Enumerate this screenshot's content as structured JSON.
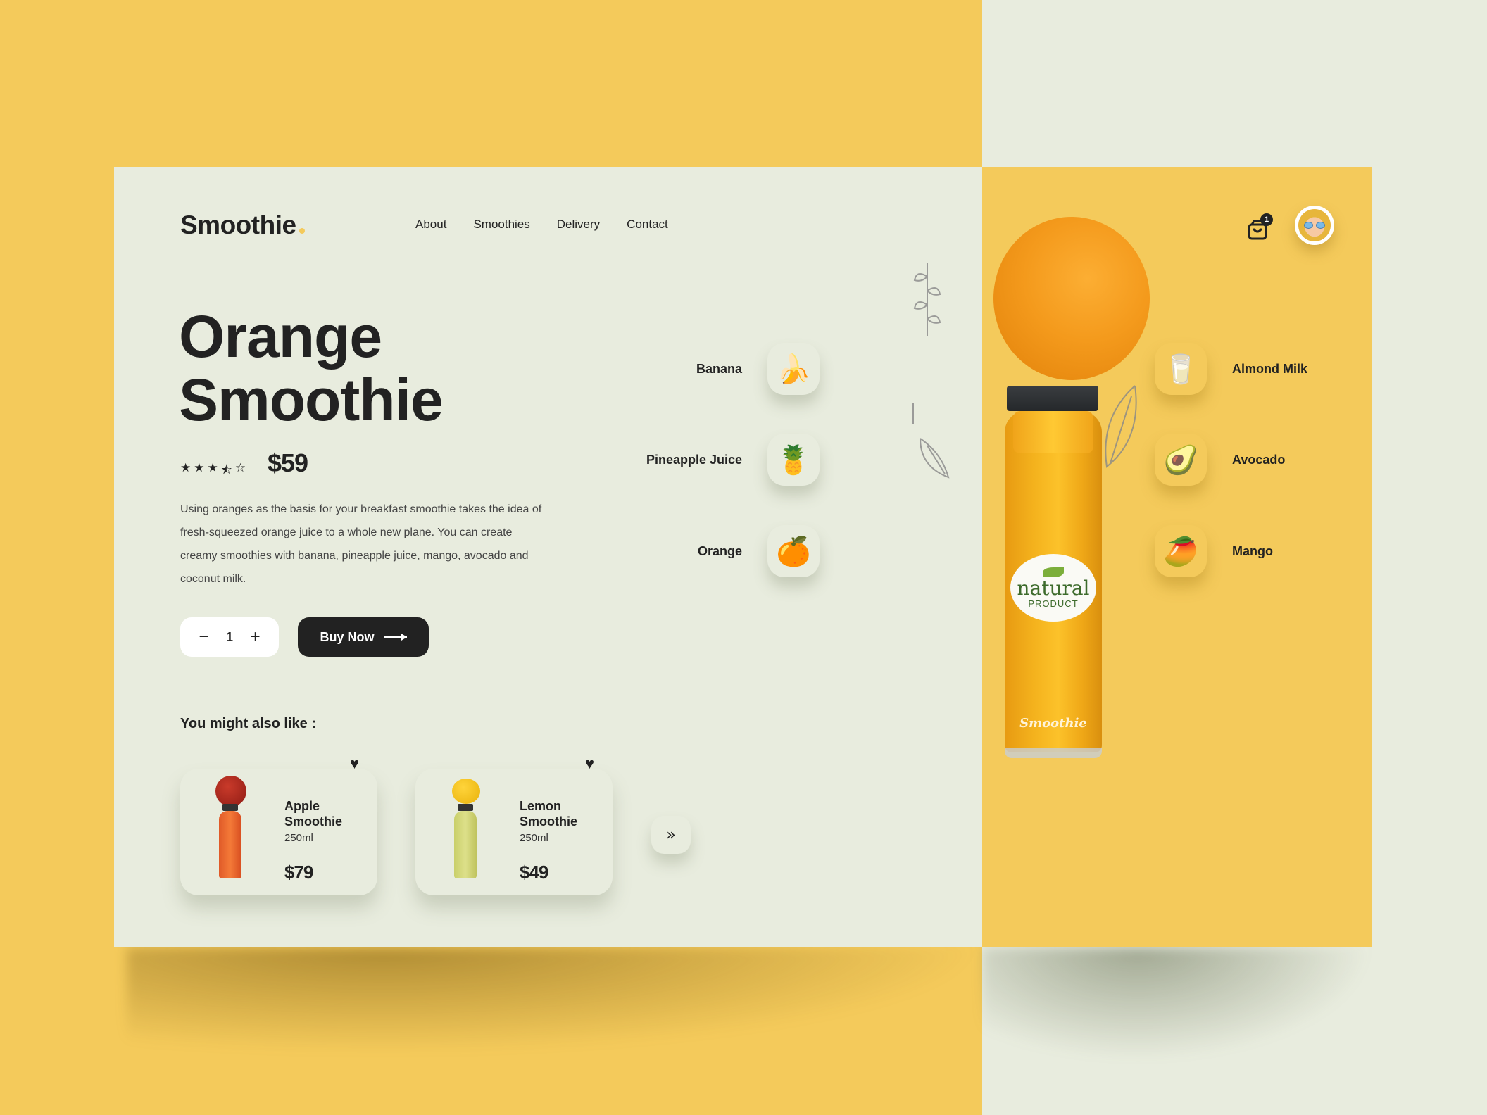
{
  "colors": {
    "accent_yellow": "#F4CA5B",
    "background_pale": "#E8ECDE",
    "text_dark": "#222222"
  },
  "header": {
    "logo": "Smoothie",
    "nav": [
      "About",
      "Smoothies",
      "Delivery",
      "Contact"
    ],
    "cart_icon": "shopping-bag-icon",
    "cart_count": "1",
    "avatar": "user-avatar"
  },
  "product": {
    "title_line1": "Orange",
    "title_line2": "Smoothie",
    "rating": {
      "value": 3.5,
      "max": 5,
      "stars": [
        "★",
        "★",
        "★",
        "⯪",
        "☆"
      ]
    },
    "price": "$59",
    "description": "Using oranges as the basis for your breakfast smoothie takes the idea of fresh-squeezed orange juice to a whole new plane. You can create creamy smoothies with banana, pineapple juice, mango, avocado and coconut milk.",
    "quantity": "1",
    "minus": "−",
    "plus": "+",
    "buy_label": "Buy Now"
  },
  "recommendations": {
    "heading": "You might also like :",
    "items": [
      {
        "name_line1": "Apple",
        "name_line2": "Smoothie",
        "volume": "250ml",
        "price": "$79",
        "favorite": true
      },
      {
        "name_line1": "Lemon",
        "name_line2": "Smoothie",
        "volume": "250ml",
        "price": "$49",
        "favorite": true
      }
    ],
    "next_label": "»"
  },
  "ingredients": {
    "left": [
      {
        "label": "Banana",
        "icon": "🍌"
      },
      {
        "label": "Pineapple Juice",
        "icon": "🍍"
      },
      {
        "label": "Orange",
        "icon": "🍊"
      }
    ],
    "right": [
      {
        "label": "Almond Milk",
        "icon": "🥛"
      },
      {
        "label": "Avocado",
        "icon": "🥑"
      },
      {
        "label": "Mango",
        "icon": "🥭"
      }
    ]
  },
  "bottle": {
    "label_main": "natural",
    "label_sub": "PRODUCT",
    "brand": "Smoothie"
  }
}
